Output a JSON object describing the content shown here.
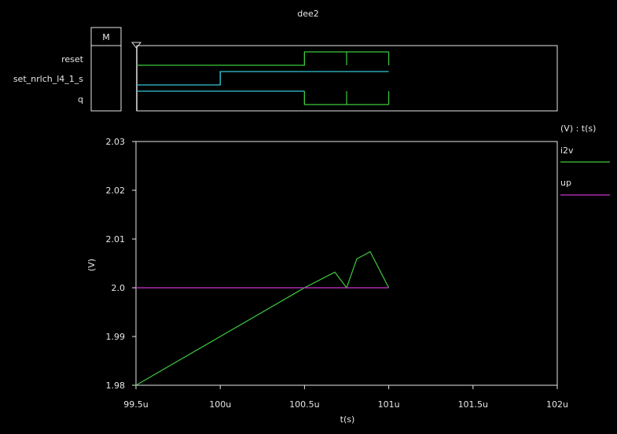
{
  "chart_data": {
    "type": "line",
    "title": "dee2",
    "digital": {
      "marker_label": "M",
      "signals": [
        {
          "name": "reset",
          "color": "#3ec93e",
          "t": [
            99.5,
            100.5,
            100.5,
            101.0
          ],
          "v": [
            0,
            0,
            1,
            1
          ],
          "edges": [
            100.5,
            100.75,
            101.0
          ]
        },
        {
          "name": "set_nrlch_l4_1_s",
          "color": "#35c6d6",
          "t": [
            99.5,
            100.0,
            100.0,
            101.0
          ],
          "v": [
            0,
            0,
            1,
            1
          ],
          "edges": [
            100.0
          ]
        },
        {
          "name": "q",
          "color": "#35c6d6",
          "second_color": "#3ec93e",
          "t": [
            99.5,
            100.5,
            100.5,
            101.0
          ],
          "v": [
            1,
            1,
            0,
            0
          ],
          "edges": [
            100.5,
            100.75,
            101.0
          ]
        }
      ]
    },
    "analog": {
      "xlabel": "t(s)",
      "ylabel": "(V)",
      "legend_header": "(V) : t(s)",
      "xlim": [
        99.5,
        102.0
      ],
      "ylim": [
        1.98,
        2.03
      ],
      "x_ticks": [
        {
          "v": 99.5,
          "label": "99.5u"
        },
        {
          "v": 100.0,
          "label": "100u"
        },
        {
          "v": 100.5,
          "label": "100.5u"
        },
        {
          "v": 101.0,
          "label": "101u"
        },
        {
          "v": 101.5,
          "label": "101.5u"
        },
        {
          "v": 102.0,
          "label": "102u"
        }
      ],
      "y_ticks": [
        {
          "v": 1.98,
          "label": "1.98"
        },
        {
          "v": 1.99,
          "label": "1.99"
        },
        {
          "v": 2.0,
          "label": "2.0"
        },
        {
          "v": 2.01,
          "label": "2.01"
        },
        {
          "v": 2.02,
          "label": "2.02"
        },
        {
          "v": 2.03,
          "label": "2.03"
        }
      ],
      "series": [
        {
          "name": "i2v",
          "color": "#3ec93e",
          "x": [
            99.5,
            100.5,
            100.68,
            100.75,
            100.81,
            100.89,
            101.0
          ],
          "y": [
            1.98,
            2.0,
            2.0032,
            2.0,
            2.0059,
            2.0074,
            2.0
          ]
        },
        {
          "name": "up",
          "color": "#cc33cc",
          "x": [
            99.5,
            101.0
          ],
          "y": [
            2.0,
            2.0
          ]
        }
      ]
    }
  }
}
